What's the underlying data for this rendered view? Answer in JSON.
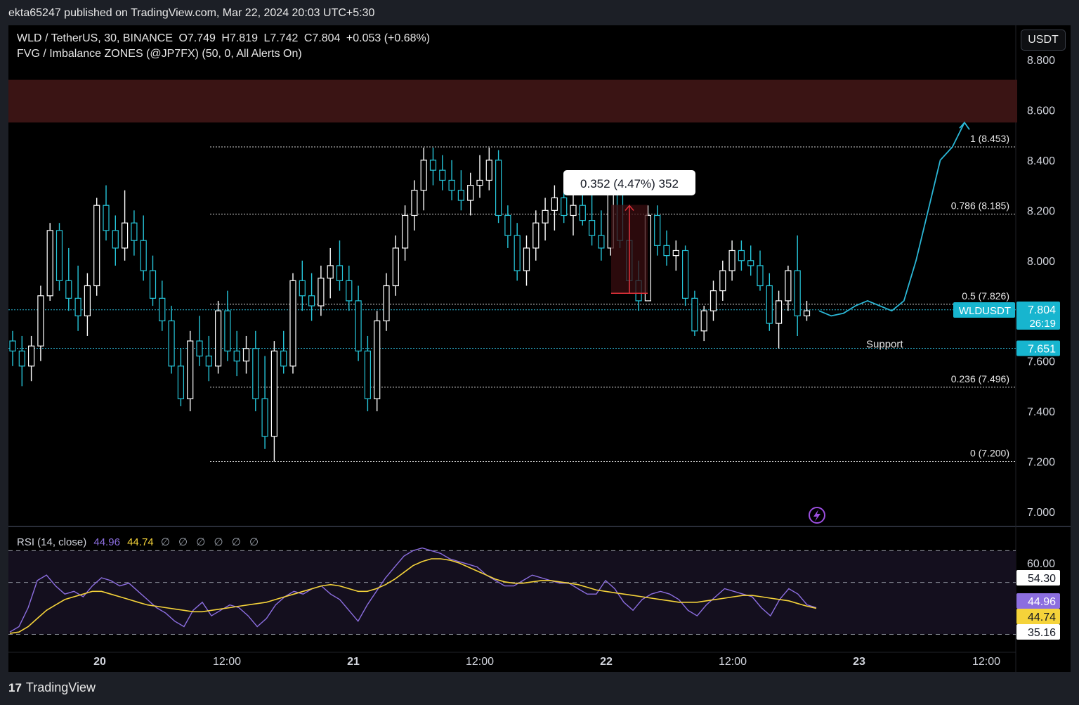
{
  "header": {
    "published": "ekta65247 published on TradingView.com, Mar 22, 2024 20:03 UTC+5:30"
  },
  "legend": {
    "symbol": "WLD / TetherUS, 30, BINANCE",
    "open": "O7.749",
    "high": "H7.819",
    "low": "L7.742",
    "close": "C7.804",
    "change": "+0.053 (+0.68%)",
    "indicator": "FVG / Imbalance ZONES (@JP7FX) (50, 0, All Alerts On)"
  },
  "currency_button": "USDT",
  "price_axis": {
    "ticks": [
      "8.800",
      "8.600",
      "8.400",
      "8.200",
      "8.000",
      "7.600",
      "7.400",
      "7.200",
      "7.000"
    ],
    "last_symbol": "WLDUSDT",
    "last_price": "7.804",
    "countdown": "26:19",
    "support_price": "7.651"
  },
  "time_axis": {
    "ticks": [
      "20",
      "12:00",
      "21",
      "12:00",
      "22",
      "12:00",
      "23",
      "12:00"
    ]
  },
  "fibonacci": [
    {
      "label": "1 (8.453)",
      "price": 8.453
    },
    {
      "label": "0.786 (8.185)",
      "price": 8.185
    },
    {
      "label": "0.5 (7.826)",
      "price": 7.826
    },
    {
      "label": "0.236 (7.496)",
      "price": 7.496
    },
    {
      "label": "0 (7.200)",
      "price": 7.2
    }
  ],
  "annotations": {
    "measure_tooltip": "0.352 (4.47%) 352",
    "support_label": "Support"
  },
  "rsi": {
    "legend_title": "RSI (14, close)",
    "rsi_value": "44.96",
    "ma_value": "44.74",
    "na_markers": "∅ ∅ ∅ ∅ ∅ ∅",
    "axis_tick": "60.00",
    "upper_band": "54.30",
    "lower_band": "35.16",
    "rsi_color": "#8c6ee0",
    "ma_color": "#f5d33a"
  },
  "colors": {
    "up": "#ffffff",
    "down": "#26c6da",
    "projection": "#2bb7d6",
    "fvg_zone": "#3a1414",
    "measure_box": "#3a0d10"
  },
  "footer": {
    "brand": "TradingView"
  },
  "chart_data": {
    "type": "candlestick",
    "title": "WLD / TetherUS, 30, BINANCE",
    "xlabel": "",
    "ylabel": "",
    "ylim": [
      6.95,
      8.85
    ],
    "x_ticks": [
      "20",
      "12:00",
      "21",
      "12:00",
      "22",
      "12:00",
      "23",
      "12:00"
    ],
    "fvg_zone": [
      8.55,
      8.72
    ],
    "support": 7.651,
    "last_price": 7.804,
    "measure": {
      "from": 7.87,
      "to": 8.222,
      "change": 0.352,
      "percent": 4.47
    },
    "ohlc": [
      [
        7.68,
        7.72,
        7.58,
        7.64
      ],
      [
        7.64,
        7.7,
        7.5,
        7.58
      ],
      [
        7.58,
        7.7,
        7.52,
        7.66
      ],
      [
        7.66,
        7.9,
        7.6,
        7.86
      ],
      [
        7.86,
        8.15,
        7.84,
        8.12
      ],
      [
        8.12,
        8.15,
        7.88,
        7.92
      ],
      [
        7.92,
        8.05,
        7.8,
        7.85
      ],
      [
        7.85,
        7.98,
        7.72,
        7.78
      ],
      [
        7.78,
        7.95,
        7.7,
        7.9
      ],
      [
        7.9,
        8.25,
        7.86,
        8.22
      ],
      [
        8.22,
        8.3,
        8.08,
        8.12
      ],
      [
        8.12,
        8.18,
        7.98,
        8.05
      ],
      [
        8.05,
        8.28,
        8.0,
        8.15
      ],
      [
        8.15,
        8.2,
        8.02,
        8.08
      ],
      [
        8.08,
        8.18,
        7.92,
        7.96
      ],
      [
        7.96,
        8.02,
        7.82,
        7.85
      ],
      [
        7.85,
        7.92,
        7.72,
        7.76
      ],
      [
        7.76,
        7.82,
        7.55,
        7.58
      ],
      [
        7.58,
        7.65,
        7.42,
        7.45
      ],
      [
        7.45,
        7.72,
        7.4,
        7.68
      ],
      [
        7.68,
        7.78,
        7.58,
        7.62
      ],
      [
        7.62,
        7.7,
        7.52,
        7.58
      ],
      [
        7.58,
        7.84,
        7.55,
        7.8
      ],
      [
        7.8,
        7.88,
        7.6,
        7.64
      ],
      [
        7.64,
        7.72,
        7.54,
        7.6
      ],
      [
        7.6,
        7.7,
        7.55,
        7.65
      ],
      [
        7.65,
        7.72,
        7.4,
        7.45
      ],
      [
        7.45,
        7.62,
        7.25,
        7.3
      ],
      [
        7.3,
        7.68,
        7.2,
        7.64
      ],
      [
        7.64,
        7.72,
        7.55,
        7.58
      ],
      [
        7.58,
        7.95,
        7.55,
        7.92
      ],
      [
        7.92,
        8.0,
        7.8,
        7.86
      ],
      [
        7.86,
        7.95,
        7.76,
        7.82
      ],
      [
        7.82,
        7.98,
        7.78,
        7.93
      ],
      [
        7.93,
        8.05,
        7.85,
        7.98
      ],
      [
        7.98,
        8.08,
        7.88,
        7.92
      ],
      [
        7.92,
        7.98,
        7.8,
        7.84
      ],
      [
        7.84,
        7.9,
        7.6,
        7.64
      ],
      [
        7.64,
        7.7,
        7.4,
        7.45
      ],
      [
        7.45,
        7.8,
        7.4,
        7.76
      ],
      [
        7.76,
        7.95,
        7.72,
        7.9
      ],
      [
        7.9,
        8.1,
        7.86,
        8.05
      ],
      [
        8.05,
        8.22,
        8.0,
        8.18
      ],
      [
        8.18,
        8.32,
        8.12,
        8.28
      ],
      [
        8.28,
        8.45,
        8.2,
        8.4
      ],
      [
        8.4,
        8.45,
        8.3,
        8.36
      ],
      [
        8.36,
        8.42,
        8.28,
        8.32
      ],
      [
        8.32,
        8.4,
        8.24,
        8.28
      ],
      [
        8.28,
        8.36,
        8.2,
        8.24
      ],
      [
        8.24,
        8.35,
        8.18,
        8.3
      ],
      [
        8.3,
        8.42,
        8.25,
        8.32
      ],
      [
        8.32,
        8.45,
        8.28,
        8.4
      ],
      [
        8.4,
        8.44,
        8.15,
        8.18
      ],
      [
        8.18,
        8.22,
        8.05,
        8.1
      ],
      [
        8.1,
        8.15,
        7.92,
        7.96
      ],
      [
        7.96,
        8.1,
        7.9,
        8.05
      ],
      [
        8.05,
        8.2,
        8.0,
        8.15
      ],
      [
        8.15,
        8.25,
        8.08,
        8.2
      ],
      [
        8.2,
        8.3,
        8.12,
        8.25
      ],
      [
        8.25,
        8.35,
        8.15,
        8.18
      ],
      [
        8.18,
        8.28,
        8.1,
        8.22
      ],
      [
        8.22,
        8.3,
        8.14,
        8.16
      ],
      [
        8.16,
        8.26,
        8.06,
        8.1
      ],
      [
        8.1,
        8.2,
        8.0,
        8.05
      ],
      [
        8.05,
        8.32,
        8.02,
        8.28
      ],
      [
        8.28,
        8.3,
        8.05,
        8.08
      ],
      [
        8.08,
        8.15,
        7.88,
        7.92
      ],
      [
        7.92,
        8.0,
        7.8,
        7.84
      ],
      [
        7.84,
        8.22,
        7.84,
        8.18
      ],
      [
        8.18,
        8.22,
        8.02,
        8.06
      ],
      [
        8.06,
        8.12,
        7.98,
        8.02
      ],
      [
        8.02,
        8.08,
        7.96,
        8.04
      ],
      [
        8.04,
        8.06,
        7.82,
        7.85
      ],
      [
        7.85,
        7.88,
        7.7,
        7.72
      ],
      [
        7.72,
        7.82,
        7.68,
        7.8
      ],
      [
        7.8,
        7.92,
        7.76,
        7.88
      ],
      [
        7.88,
        8.0,
        7.84,
        7.96
      ],
      [
        7.96,
        8.08,
        7.92,
        8.04
      ],
      [
        8.04,
        8.08,
        7.96,
        8.0
      ],
      [
        8.0,
        8.06,
        7.94,
        7.98
      ],
      [
        7.98,
        8.04,
        7.88,
        7.9
      ],
      [
        7.9,
        7.95,
        7.72,
        7.75
      ],
      [
        7.75,
        7.88,
        7.65,
        7.84
      ],
      [
        7.84,
        7.98,
        7.8,
        7.96
      ],
      [
        7.96,
        8.1,
        7.7,
        7.78
      ],
      [
        7.78,
        7.84,
        7.76,
        7.8
      ]
    ],
    "projection": [
      7.8,
      7.78,
      7.79,
      7.82,
      7.84,
      7.82,
      7.8,
      7.84,
      8.0,
      8.2,
      8.4,
      8.453,
      8.55
    ],
    "rsi": {
      "name": "RSI (14, close)",
      "values": [
        36,
        38,
        45,
        55,
        57,
        53,
        50,
        51,
        49,
        53,
        56,
        55,
        53,
        54,
        51,
        48,
        45,
        43,
        40,
        38,
        44,
        47,
        42,
        44,
        46,
        45,
        42,
        38,
        41,
        46,
        49,
        51,
        50,
        52,
        53,
        50,
        48,
        44,
        40,
        46,
        51,
        56,
        60,
        64,
        66,
        67,
        66,
        65,
        63,
        62,
        61,
        60,
        57,
        55,
        53,
        53,
        55,
        57,
        56,
        55,
        54,
        54,
        52,
        50,
        50,
        55,
        52,
        47,
        44,
        48,
        50,
        51,
        50,
        48,
        44,
        42,
        46,
        49,
        52,
        51,
        50,
        49,
        45,
        42,
        48,
        52,
        50,
        46,
        44.96
      ],
      "ma_name": "MA",
      "ma_values": [
        35.5,
        36,
        38,
        41,
        44,
        46,
        48,
        49,
        50,
        51,
        51,
        50,
        49,
        48,
        47,
        46,
        45.5,
        45,
        44.5,
        44,
        43.5,
        43.5,
        44,
        44.5,
        45,
        45.5,
        46,
        46.5,
        47,
        48,
        49,
        50,
        51,
        52,
        53,
        53.5,
        53,
        52,
        51,
        51,
        52,
        53.5,
        55.5,
        58,
        60.5,
        62,
        63,
        63,
        62.5,
        61.5,
        60,
        58.5,
        57,
        55.5,
        54.5,
        54,
        54,
        54.5,
        55,
        55,
        54.5,
        54,
        53.5,
        52.5,
        51.5,
        51,
        50.5,
        50,
        49.5,
        49,
        48.5,
        48,
        47.5,
        47,
        47,
        47,
        47.5,
        48,
        48.5,
        49,
        49.5,
        49.5,
        49,
        48.5,
        48,
        47.5,
        46.5,
        45.5,
        44.74
      ],
      "bands": [
        35.16,
        54.3,
        66
      ],
      "ylim": [
        34,
        70
      ]
    }
  }
}
